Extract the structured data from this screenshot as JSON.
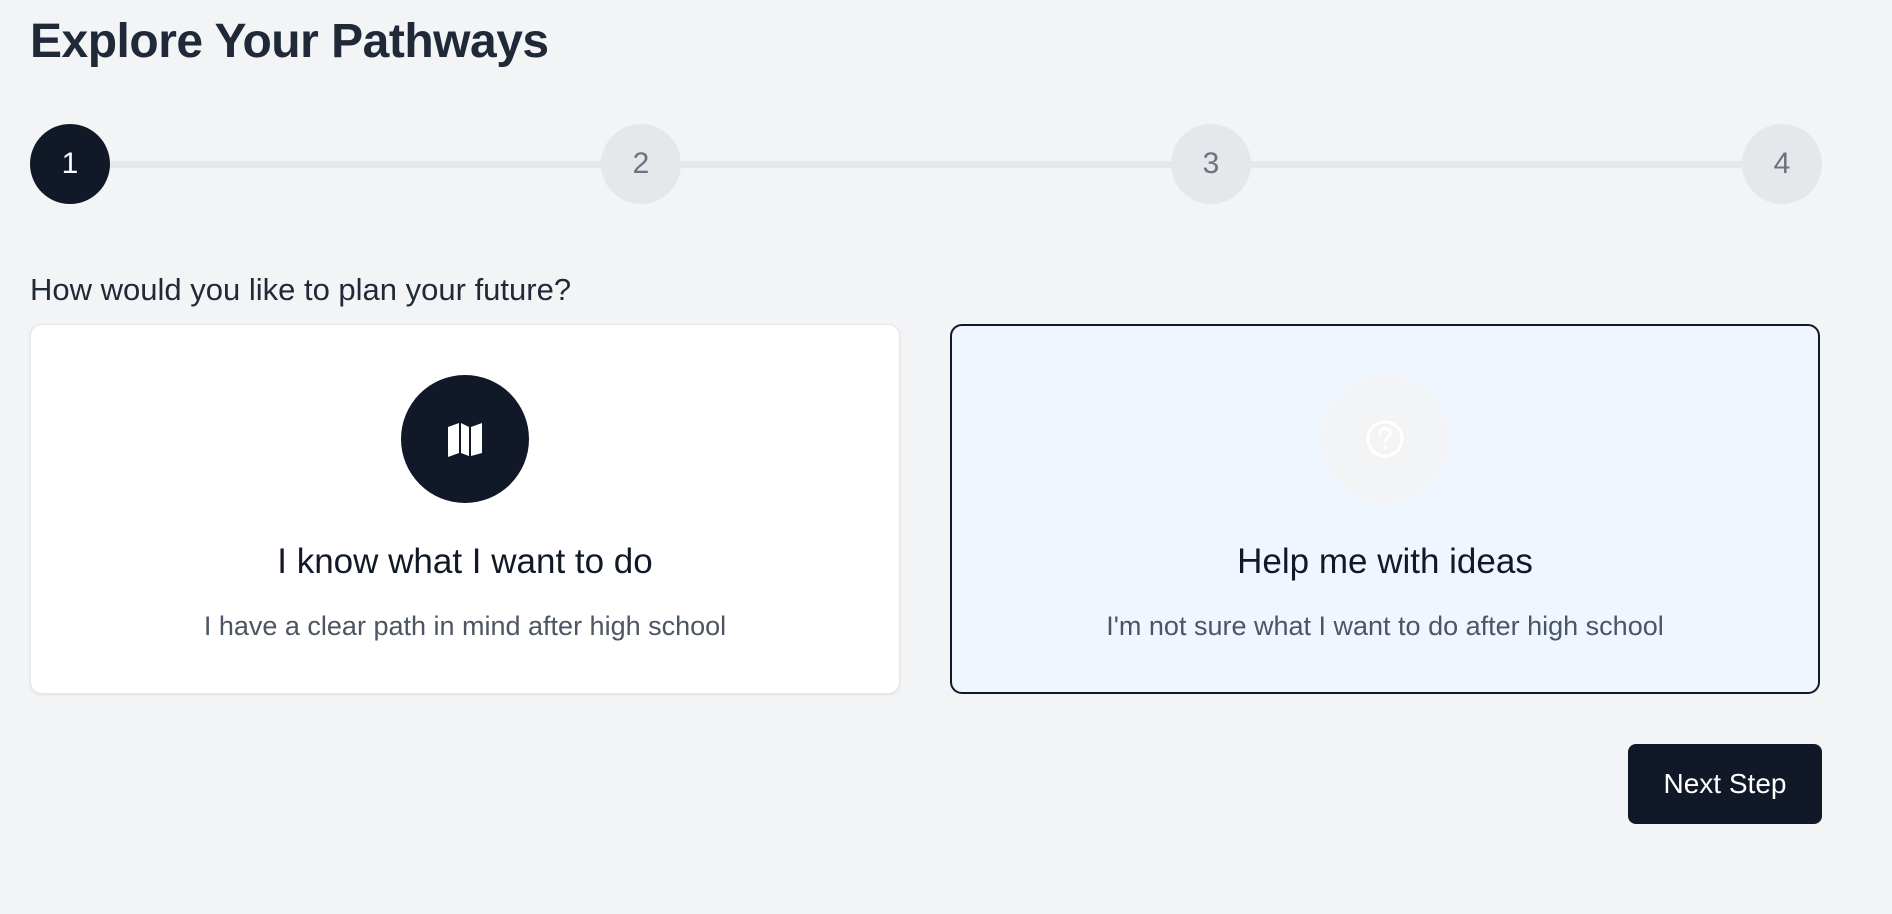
{
  "page": {
    "title": "Explore Your Pathways"
  },
  "stepper": {
    "current_step": 1,
    "steps": [
      {
        "label": "1"
      },
      {
        "label": "2"
      },
      {
        "label": "3"
      },
      {
        "label": "4"
      }
    ]
  },
  "question": "How would you like to plan your future?",
  "options": [
    {
      "icon": "map-icon",
      "title": "I know what I want to do",
      "description": "I have a clear path in mind after high school",
      "selected": false
    },
    {
      "icon": "question-circle-icon",
      "title": "Help me with ideas",
      "description": "I'm not sure what I want to do after high school",
      "selected": true
    }
  ],
  "actions": {
    "next_label": "Next Step"
  },
  "colors": {
    "background": "#f3f4f6",
    "primary": "#111827",
    "selected_card_bg": "#eff6ff",
    "inactive_step": "#e5e7eb"
  }
}
